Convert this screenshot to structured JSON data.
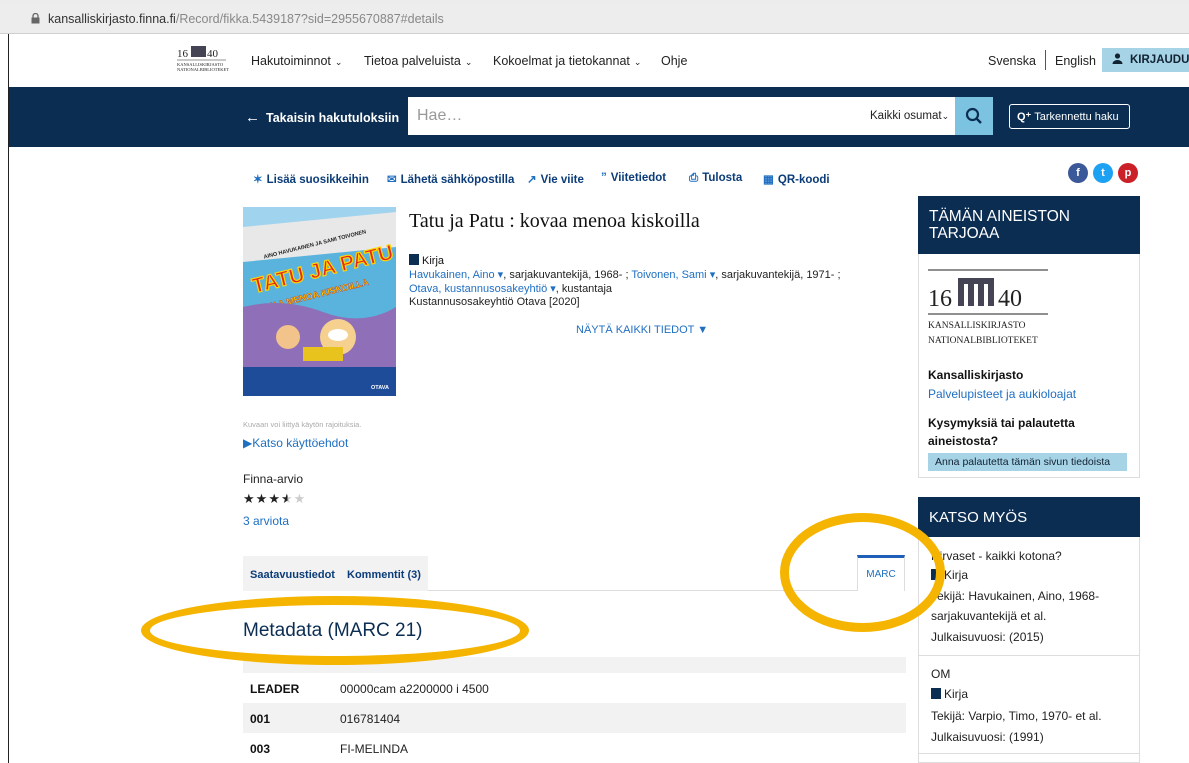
{
  "browser": {
    "url_host": "kansalliskirjasto.finna.fi",
    "url_path": "/Record/fikka.5439187?sid=2955670887#details"
  },
  "nav": {
    "items": [
      "Hakutoiminnot",
      "Tietoa palveluista",
      "Kokoelmat ja tietokannat",
      "Ohje"
    ],
    "lang_sv": "Svenska",
    "lang_en": "English",
    "login": "KIRJAUDU"
  },
  "search": {
    "back": "Takaisin hakutuloksiin",
    "placeholder": "Hae…",
    "scope": "Kaikki osumat",
    "advanced": "Tarkennettu haku"
  },
  "actions": {
    "favorite": "Lisää suosikkeihin",
    "email": "Lähetä sähköpostilla",
    "export": "Vie viite",
    "cite": "Viitetiedot",
    "print": "Tulosta",
    "qr": "QR-koodi"
  },
  "social": {
    "facebook": "f",
    "twitter": "t",
    "pinterest": "p"
  },
  "cover": {
    "series": "TATU JA PATU",
    "subtitle": "KOVAA MENOA KISKOILLA",
    "authors": "AINO HAVUKAINEN JA SAMI TOIVONEN",
    "publisher": "OTAVA"
  },
  "record": {
    "title": "Tatu ja Patu : kovaa menoa kiskoilla",
    "format": "Kirja",
    "author1": "Havukainen, Aino",
    "author1_role": ", sarjakuvantekijä, 1968- ;",
    "author2": "Toivonen, Sami",
    "author2_role": ", sarjakuvantekijä, 1971- ;",
    "publisher_link": "Otava, kustannusosakeyhtiö",
    "publisher_role": ", kustantaja",
    "imprint": "Kustannusosakeyhtiö Otava [2020]",
    "show_all": "NÄYTÄ KAIKKI TIEDOT"
  },
  "image_note": "Kuvaan voi liittyä käytön rajoituksia.",
  "terms": "Katso käyttöehdot",
  "rating": {
    "label": "Finna-arvio",
    "stars": 3.5,
    "max": 5,
    "reviews": "3 arviota"
  },
  "tabs": {
    "availability": "Saatavuustiedot",
    "comments": "Kommentit (3)",
    "marc": "MARC"
  },
  "marc": {
    "heading": "Metadata (MARC 21)",
    "rows": [
      {
        "tag": "LEADER",
        "value": "00000cam a2200000 i 4500"
      },
      {
        "tag": "001",
        "value": "016781404"
      },
      {
        "tag": "003",
        "value": "FI-MELINDA"
      }
    ]
  },
  "sidebar": {
    "provider_heading": "TÄMÄN AINEISTON TARJOAA",
    "logo_year_left": "16",
    "logo_year_right": "40",
    "logo_line1": "KANSALLISKIRJASTO",
    "logo_line2": "NATIONALBIBLIOTEKET",
    "library": "Kansalliskirjasto",
    "services": "Palvelupisteet ja aukioloajat",
    "question": "Kysymyksiä tai palautetta aineistosta?",
    "feedback": "Anna palautetta tämän sivun tiedoista",
    "see_also_heading": "KATSO MYÖS",
    "see_also": [
      {
        "title": "Hirvaset - kaikki kotona?",
        "format": "Kirja",
        "authors": "Tekijä: Havukainen, Aino, 1968-",
        "authors2": "sarjakuvantekijä et al.",
        "year": "Julkaisuvuosi: (2015)"
      },
      {
        "title": "OM",
        "format": "Kirja",
        "authors": "Tekijä: Varpio, Timo, 1970- et al.",
        "year": "Julkaisuvuosi: (1991)"
      }
    ]
  },
  "colors": {
    "navy": "#0b2d52",
    "link": "#1f6fc2",
    "highlight": "#f5b400",
    "login": "#a7d3e6"
  }
}
